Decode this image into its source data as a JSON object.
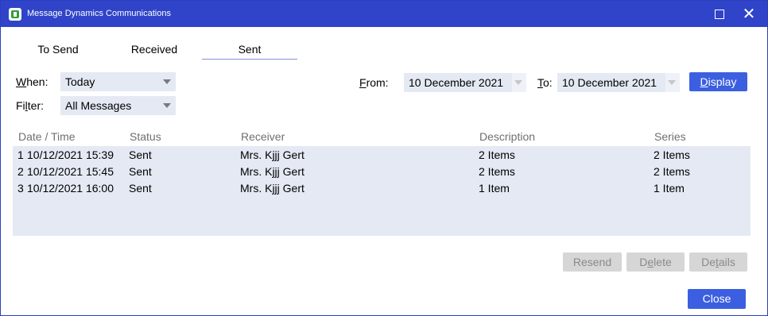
{
  "window": {
    "title": "Message Dynamics Communications"
  },
  "tabs": [
    {
      "label": "To Send"
    },
    {
      "label": "Received"
    },
    {
      "label": "Sent"
    }
  ],
  "filters": {
    "when_label": "When:",
    "when_value": "Today",
    "filter_label": "Filter:",
    "filter_value": "All Messages",
    "from_label": "From:",
    "from_value": "10 December 2021",
    "to_label": "To:",
    "to_value": "10 December 2021",
    "display_button": "Display"
  },
  "table": {
    "columns": [
      "Date / Time",
      "Status",
      "Receiver",
      "Description",
      "Series"
    ],
    "rows": [
      {
        "num": "1",
        "datetime": "10/12/2021 15:39",
        "status": "Sent",
        "receiver": "Mrs. Kjjj Gert",
        "description": "2 Items",
        "series": "2 Items"
      },
      {
        "num": "2",
        "datetime": "10/12/2021 15:45",
        "status": "Sent",
        "receiver": "Mrs. Kjjj Gert",
        "description": "2 Items",
        "series": "2 Items"
      },
      {
        "num": "3",
        "datetime": "10/12/2021 16:00",
        "status": "Sent",
        "receiver": "Mrs. Kjjj Gert",
        "description": "1 Item",
        "series": "1 Item"
      }
    ]
  },
  "actions": {
    "resend": "Resend",
    "delete": "Delete",
    "details": "Details",
    "close": "Close"
  },
  "colors": {
    "titlebar": "#2f44c8",
    "accent_button": "#3b5fe0",
    "grid_background": "#e4e9f3"
  },
  "icons": {
    "app": "app-logo-icon",
    "maximize": "maximize-icon",
    "close": "close-icon"
  }
}
